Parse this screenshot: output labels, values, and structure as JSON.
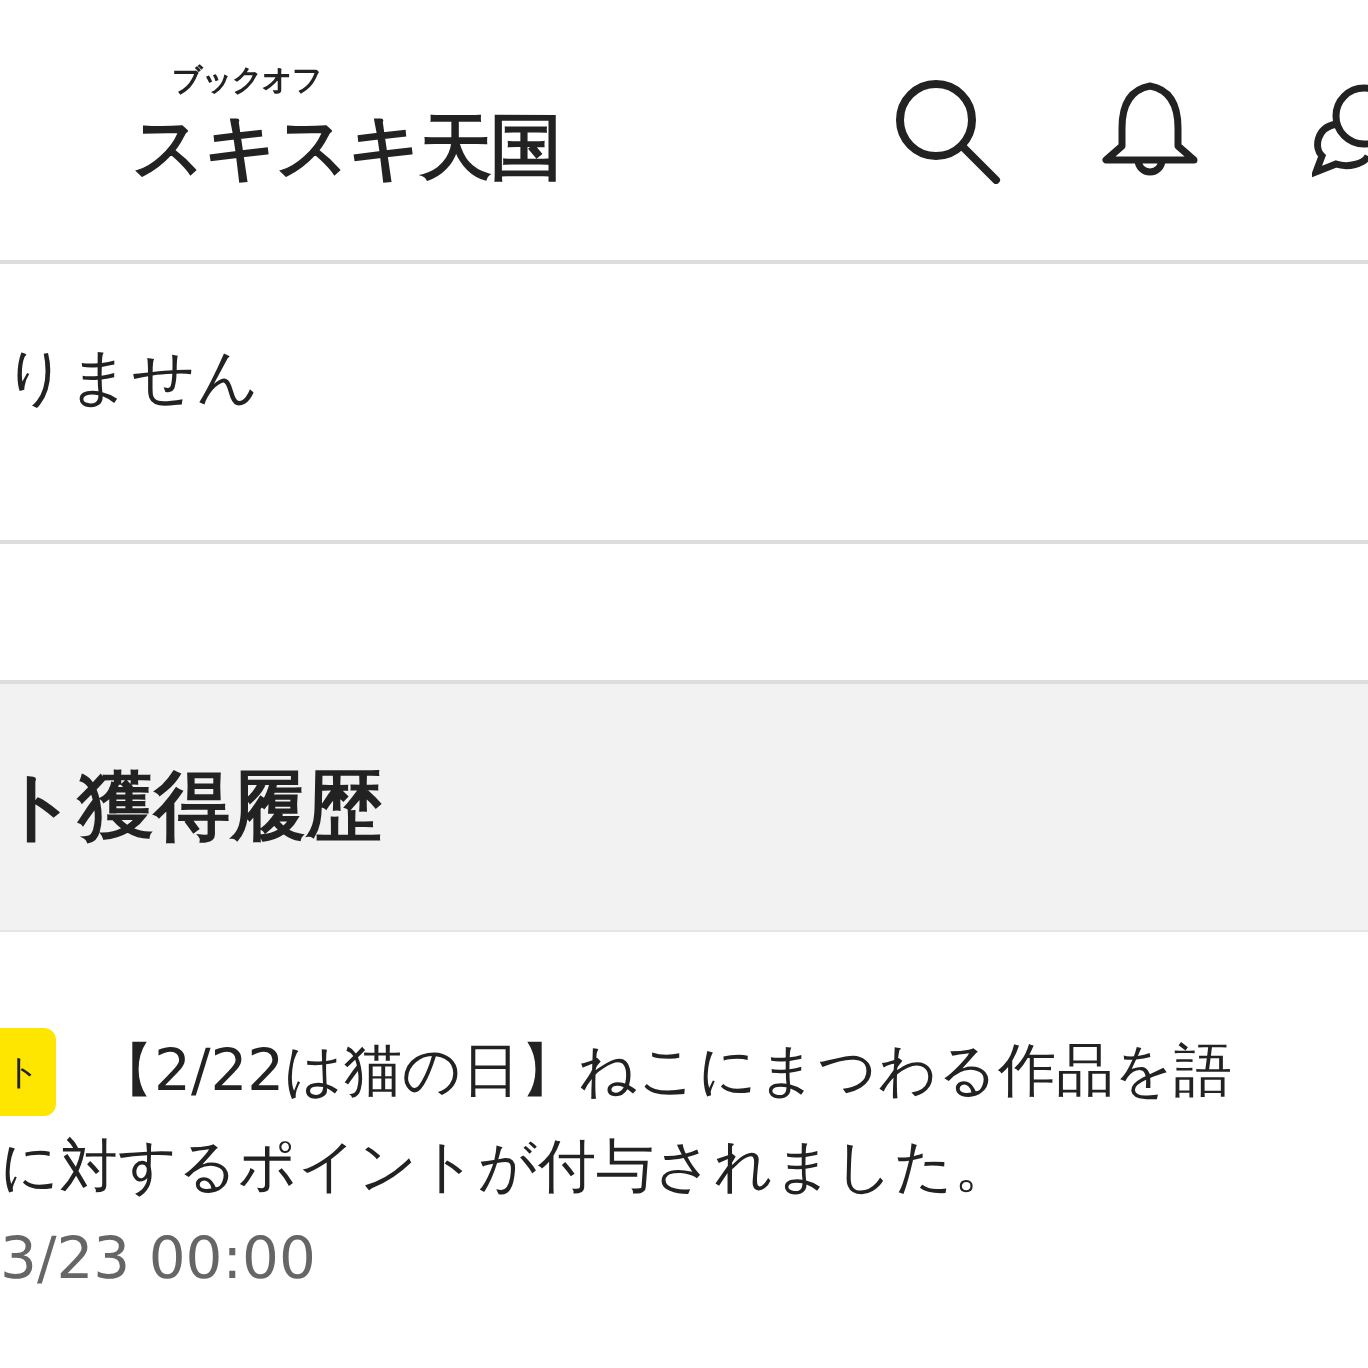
{
  "header": {
    "logo": {
      "small": "ブックオフ",
      "main": "スキスキ天国"
    }
  },
  "notice": {
    "text": "りません"
  },
  "section": {
    "title": "ト獲得履歴"
  },
  "history": [
    {
      "badge": "ト",
      "lines": [
        "【2/22は猫の日】ねこにまつわる作品を語",
        "に対するポイントが付与されました。"
      ],
      "date": "3/23 00:00"
    }
  ]
}
